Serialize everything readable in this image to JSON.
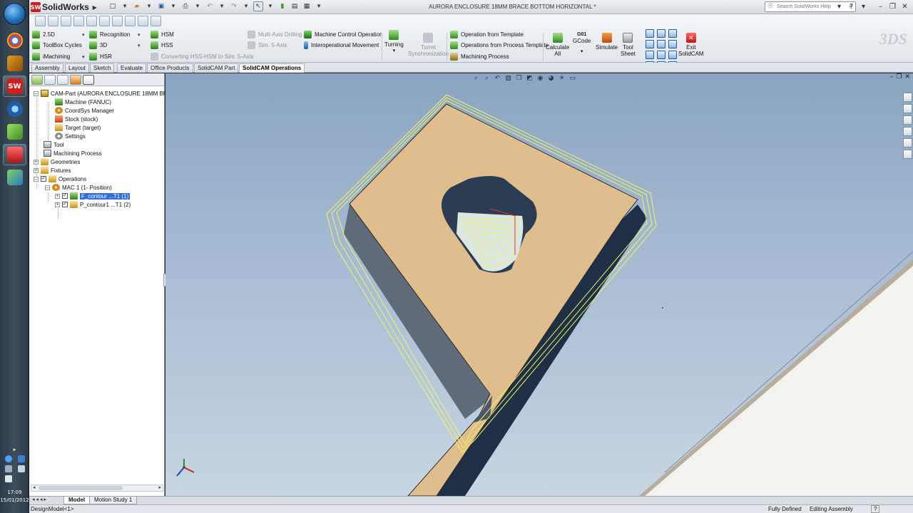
{
  "app": {
    "name": "SolidWorks",
    "document_title": "AURORA ENCLOSURE 18MM BRACE BOTTOM HORIZONTAL *",
    "search_placeholder": "Search SolidWorks Help"
  },
  "clock": {
    "time": "17:09",
    "date": "15/01/2012"
  },
  "ribbon": {
    "col1": [
      "2.5D",
      "ToolBox Cycles",
      "iMachining"
    ],
    "col2": [
      "Recognition",
      "3D",
      "HSR"
    ],
    "col3": [
      "HSM",
      "HSS"
    ],
    "converting": "Converting HSS-HSM to Sim. 5-Axis",
    "col4": [
      "Multi-Axis Drilling",
      "Sim. 5-Axis"
    ],
    "col5": [
      "Machine Control Operation",
      "Interoperational Movement"
    ],
    "turning": "Turning",
    "turret_sync": [
      "Turret",
      "Synchronization"
    ],
    "col6": [
      "Operation from Template",
      "Operations from Process Template",
      "Machining Process"
    ],
    "calculate_all": [
      "Calculate",
      "All"
    ],
    "gcode_top": "G01",
    "gcode": "GCode",
    "simulate": "Simulate",
    "tool_sheet": [
      "Tool",
      "Sheet"
    ],
    "exit": [
      "Exit",
      "SolidCAM"
    ],
    "watermark": "3DS"
  },
  "tabs": [
    "Assembly",
    "Layout",
    "Sketch",
    "Evaluate",
    "Office Products",
    "SolidCAM Part",
    "SolidCAM Operations"
  ],
  "tree": {
    "root": "CAM-Part (AURORA ENCLOSURE 18MM BRACE B",
    "machine": "Machine (FANUC)",
    "coordsys": "CoordSys Manager",
    "stock": "Stock (stock)",
    "target": "Target (target)",
    "settings": "Settings",
    "tool": "Tool",
    "machining_process": "Machining Process",
    "geometries": "Geometries",
    "fixtures": "Fixtures",
    "operations": "Operations",
    "mac": "MAC 1 (1- Position)",
    "op1": "F_contour ...T1 (1)",
    "op2": "P_contour1 ...T1 (2)"
  },
  "bottom_tabs": [
    "Model",
    "Motion Study 1"
  ],
  "status": {
    "left": "DesignModel<1>",
    "fully_defined": "Fully Defined",
    "mode": "Editing Assembly",
    "help": "?"
  },
  "colors": {
    "part_top": "#e0bd8d",
    "part_side": "#5f6b78",
    "part_dark_side": "#1f3046",
    "toolpath": "#f2f25c",
    "viewport_bg": "#a7bcd3",
    "accent_red": "#d21d1d"
  }
}
